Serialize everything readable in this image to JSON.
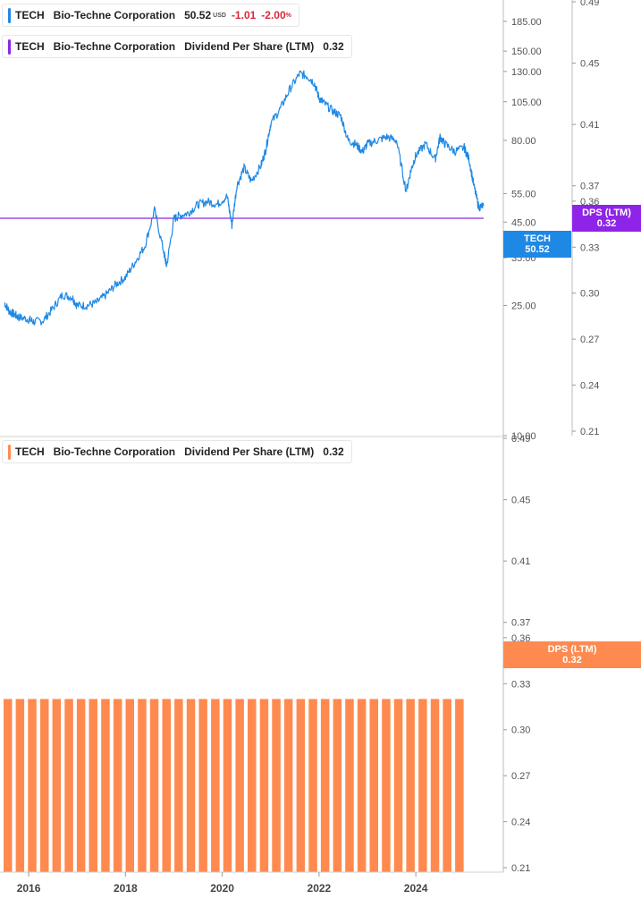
{
  "legends": {
    "price": {
      "ticker": "TECH",
      "company": "Bio-Techne Corporation",
      "price": "50.52",
      "currency": "USD",
      "change": "-1.01",
      "change_pct": "-2.00",
      "pct_sign": "%",
      "color": "#1e88e5"
    },
    "dps_top": {
      "ticker": "TECH",
      "company": "Bio-Techne Corporation",
      "metric": "Dividend Per Share (LTM)",
      "value": "0.32",
      "color": "#8e24e8"
    },
    "dps_bottom": {
      "ticker": "TECH",
      "company": "Bio-Techne Corporation",
      "metric": "Dividend Per Share (LTM)",
      "value": "0.32",
      "color": "#ff8a50"
    }
  },
  "tags": {
    "price_tag": {
      "line1": "TECH",
      "line2": "50.52",
      "color": "#1e88e5"
    },
    "dps_top_tag": {
      "line1": "DPS (LTM)",
      "line2": "0.32",
      "color": "#8e24e8"
    },
    "dps_bottom_tag": {
      "line1": "DPS (LTM)",
      "line2": "0.32",
      "color": "#ff8a50"
    }
  },
  "chart_data": [
    {
      "type": "line",
      "series": [
        {
          "name": "TECH",
          "color": "#1e88e5",
          "x": [
            2015.5,
            2015.6,
            2015.7,
            2015.8,
            2016.0,
            2016.1,
            2016.3,
            2016.5,
            2016.7,
            2016.9,
            2017.0,
            2017.2,
            2017.4,
            2017.6,
            2017.8,
            2018.0,
            2018.2,
            2018.4,
            2018.6,
            2018.8,
            2018.85,
            2019.0,
            2019.1,
            2019.3,
            2019.5,
            2019.7,
            2019.9,
            2020.1,
            2020.2,
            2020.3,
            2020.45,
            2020.6,
            2020.8,
            2020.9,
            2021.0,
            2021.2,
            2021.4,
            2021.6,
            2021.75,
            2021.9,
            2022.0,
            2022.1,
            2022.3,
            2022.45,
            2022.6,
            2022.75,
            2022.9,
            2023.0,
            2023.2,
            2023.4,
            2023.6,
            2023.8,
            2023.9,
            2024.0,
            2024.2,
            2024.4,
            2024.5,
            2024.6,
            2024.8,
            2025.0,
            2025.1,
            2025.2,
            2025.3,
            2025.4
          ],
          "y": [
            25.5,
            24,
            23.5,
            23,
            22.7,
            22.3,
            22.5,
            24.5,
            27,
            26.5,
            25,
            25,
            25.5,
            27,
            29,
            30.5,
            34,
            38,
            49,
            36,
            33,
            46,
            47,
            48,
            51,
            52,
            51,
            54,
            44,
            58,
            66,
            60,
            67,
            75,
            90,
            100,
            115,
            128,
            126,
            120,
            108,
            104,
            98,
            95,
            80,
            78,
            74,
            78,
            80,
            82,
            80,
            56,
            65,
            72,
            78,
            70,
            82,
            78,
            74,
            76,
            70,
            58,
            50,
            50.52
          ]
        }
      ],
      "yscale": "log",
      "ylim": [
        10,
        240
      ],
      "xlim": [
        2015.5,
        2025.9
      ],
      "yticks": [
        10,
        25,
        35,
        45,
        55,
        80,
        105,
        130,
        150,
        185
      ],
      "ytick_labels": [
        "10.00",
        "25.00",
        "35.00",
        "45.00",
        "55.00",
        "80.00",
        "105.00",
        "130.00",
        "150.00",
        "185.00"
      ],
      "overlay": {
        "name": "DPS (LTM)",
        "color": "#8e24e8",
        "value": 0.32,
        "yticks": [
          0.21,
          0.24,
          0.27,
          0.3,
          0.33,
          0.36,
          0.37,
          0.41,
          0.45,
          0.49
        ],
        "ytick_labels": [
          "0.21",
          "0.24",
          "0.27",
          "0.30",
          "0.33",
          "0.36",
          "0.37",
          "0.41",
          "0.45",
          "0.49"
        ]
      },
      "grid": false
    },
    {
      "type": "bar",
      "series": [
        {
          "name": "DPS (LTM)",
          "color": "#ff8a50",
          "value_per_quarter": 0.32,
          "count": 38
        }
      ],
      "yticks": [
        0.21,
        0.24,
        0.27,
        0.3,
        0.33,
        0.36,
        0.37,
        0.41,
        0.45,
        0.49
      ],
      "ytick_labels": [
        "0.21",
        "0.24",
        "0.27",
        "0.30",
        "0.33",
        "0.36",
        "0.37",
        "0.41",
        "0.45",
        "0.49"
      ],
      "xtick_labels": [
        "2016",
        "2018",
        "2020",
        "2022",
        "2024"
      ],
      "xticks": [
        2016,
        2018,
        2020,
        2022,
        2024
      ],
      "grid": false
    }
  ]
}
